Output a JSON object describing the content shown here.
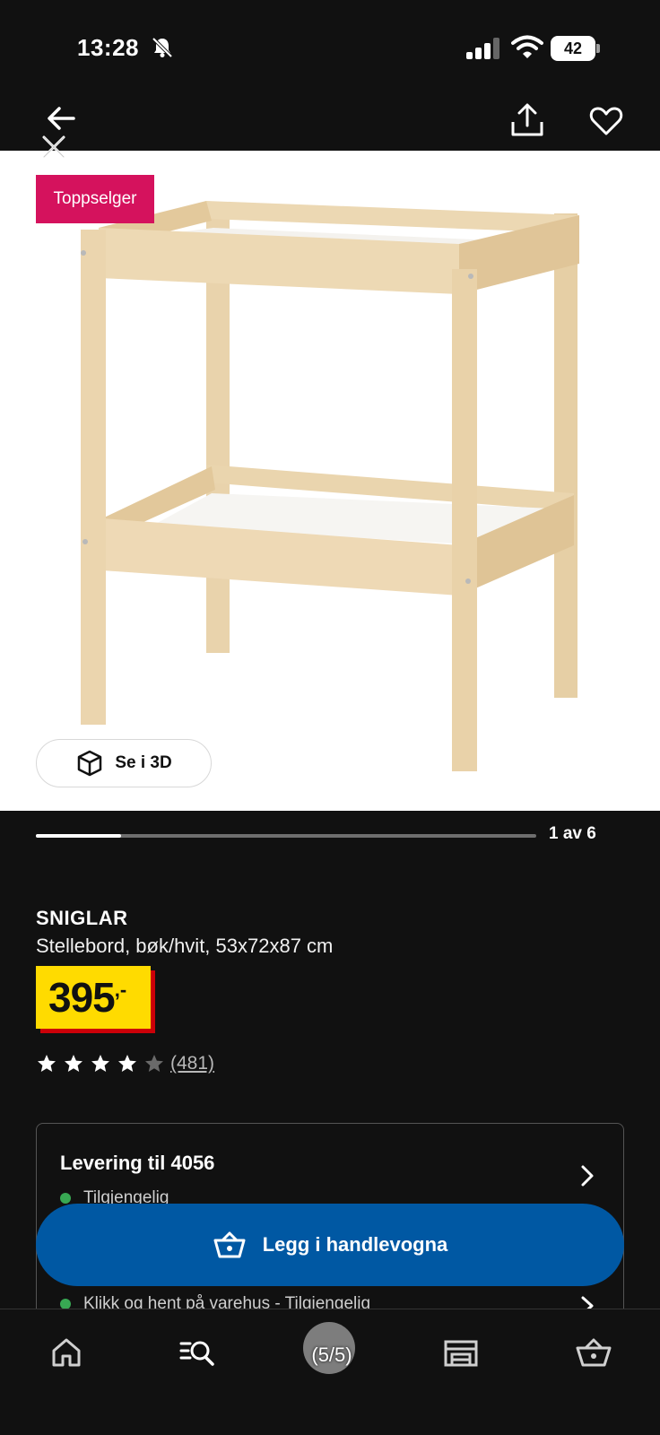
{
  "status_bar": {
    "time": "13:28",
    "battery": "42"
  },
  "badge": "Toppselger",
  "view_3d_label": "Se i 3D",
  "carousel": {
    "label": "1 av 6",
    "progress": 0.17
  },
  "product": {
    "name": "SNIGLAR",
    "description": "Stellebord, bøk/hvit, 53x72x87 cm",
    "price": "395",
    "price_suffix": ",-",
    "rating": 4,
    "rating_max": 5,
    "reviews": "(481)"
  },
  "delivery": {
    "title": "Levering til 4056",
    "status": "Tilgjengelig",
    "pickup": "Klikk og hent på varehus - Tilgjengelig"
  },
  "cart_button": "Legg i handlevogna",
  "overlay": {
    "counter": "(5/5)"
  },
  "colors": {
    "badge": "#d5125d",
    "price_bg": "#ffdb00",
    "price_shadow": "#cc0008",
    "cart_button": "#0058a3",
    "available": "#38a853"
  },
  "icons": [
    "back-arrow-icon",
    "share-icon",
    "heart-icon",
    "close-icon",
    "cube-3d-icon",
    "chevron-right-icon",
    "cart-icon",
    "home-icon",
    "search-list-icon",
    "store-icon",
    "basket-icon"
  ]
}
